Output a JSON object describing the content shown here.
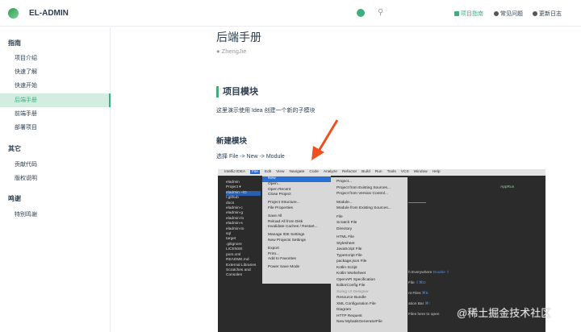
{
  "header": {
    "brand": "EL-ADMIN",
    "nav": [
      "项目指南",
      "常见问题",
      "更新日志"
    ]
  },
  "sidebar": {
    "groups": [
      {
        "title": "指南",
        "items": [
          "项目介绍",
          "快速了解",
          "快速开始",
          "后端手册",
          "前端手册",
          "部署项目"
        ]
      },
      {
        "title": "其它",
        "items": [
          "贡献代码",
          "版权说明"
        ]
      },
      {
        "title": "鸣谢",
        "items": [
          "特别鸣谢"
        ]
      }
    ],
    "active": "后端手册"
  },
  "main": {
    "title": "后端手册",
    "author": "ZhengJie",
    "h2": "项目模块",
    "p1": "这里演示使用 Idea 创建一个新的子模块",
    "h3": "新建模块",
    "p2": "选择 File -> New -> Module"
  },
  "ide": {
    "menubar": [
      "IntelliJ IDEA",
      "File",
      "Edit",
      "View",
      "Navigate",
      "Code",
      "Analyze",
      "Refactor",
      "Build",
      "Run",
      "Tools",
      "VCS",
      "Window",
      "Help"
    ],
    "tree": [
      "eladmin",
      "Project ▾",
      "eladmin ~/D",
      "/.github",
      "docs",
      "eladmin-c",
      "eladmin-g",
      "eladmin-lo",
      "eladmin-s",
      "eladmin-to",
      "sql",
      "target",
      ".gitignore",
      "LICENSE",
      "pom.xml",
      "README.md",
      "External Libraries",
      "Scratches and Consoles"
    ],
    "file_menu": [
      "New",
      "Open...",
      "Open Recent",
      "Close Project",
      "Project Structure...",
      "File Properties",
      "Save All",
      "Reload All from Disk",
      "Invalidate Caches / Restart...",
      "Manage IDE Settings",
      "New Projects Settings",
      "Export",
      "Print...",
      "Add to Favorites",
      "Power Save Mode"
    ],
    "new_menu": [
      "Project...",
      "Project from Existing Sources...",
      "Project from Version Control...",
      "Module...",
      "Module from Existing Sources...",
      "File",
      "Scratch File",
      "Directory",
      "HTML File",
      "Stylesheet",
      "JavaScript File",
      "TypeScript File",
      "package.json File",
      "Kotlin Script",
      "Kotlin Worksheet",
      "OpenAPI Specification",
      "EditorConfig File",
      "Swing UI Designer",
      "Resource Bundle",
      "XML Configuration File",
      "Diagram",
      "HTTP Request",
      "New MybatisGeneratorFile"
    ],
    "hints": [
      {
        "t": "h Everywhere",
        "k": "Double ⇧"
      },
      {
        "t": "File",
        "k": "⇧⌘O"
      },
      {
        "t": "nt Files",
        "k": "⌘E"
      },
      {
        "t": "ation Bar",
        "k": "⌘↑"
      },
      {
        "t": "Files here to open",
        "k": ""
      }
    ],
    "run_config": "AppRun"
  },
  "watermark": "@稀土掘金技术社区",
  "colors": {
    "accent": "#3eaf7c",
    "arrow": "#f0501e"
  }
}
